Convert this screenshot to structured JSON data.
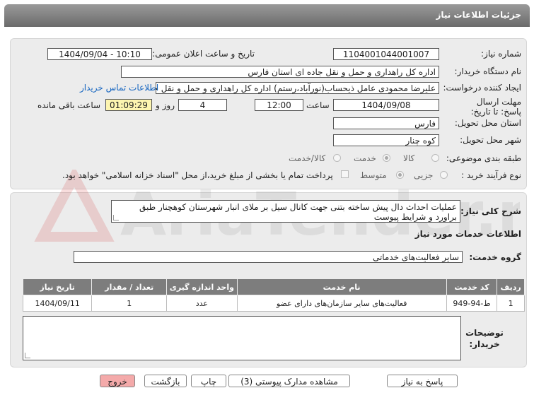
{
  "header": {
    "title": "جزئیات اطلاعات نیاز"
  },
  "form": {
    "need_number_label": "شماره نیاز:",
    "need_number": "1104001044001007",
    "announce_label": "تاریخ و ساعت اعلان عمومی:",
    "announce_value": "1404/09/04 - 10:10",
    "buyer_org_label": "نام دستگاه خریدار:",
    "buyer_org": "اداره کل راهداری و حمل و نقل جاده ای استان فارس",
    "creator_label": "ایجاد کننده درخواست:",
    "creator": "علیرضا محمودی عامل ذیحساب(نورآباد،رستم) اداره کل راهداری و حمل و نقل جا",
    "contact_link": "اطلاعات تماس خریدار",
    "deadline_label": "مهلت ارسال پاسخ: تا تاریخ:",
    "deadline_date": "1404/09/08",
    "time_label": "ساعت",
    "deadline_time": "12:00",
    "days_value": "4",
    "days_label": "روز و",
    "remaining_time": "01:09:29",
    "remaining_label": "ساعت باقی مانده",
    "province_label": "استان محل تحویل:",
    "province": "فارس",
    "city_label": "شهر محل تحویل:",
    "city": "کوه چنار",
    "category_label": "طبقه بندی موضوعی:",
    "category_options": [
      "کالا",
      "خدمت",
      "کالا/خدمت"
    ],
    "category_selected": "خدمت",
    "process_label": "نوع فرآیند خرید :",
    "process_options": [
      "جزیی",
      "متوسط"
    ],
    "process_selected": "متوسط",
    "payment_note": "پرداخت تمام یا بخشی از مبلغ خرید،از محل \"اسناد خزانه اسلامی\" خواهد بود."
  },
  "details": {
    "description_label": "شرح کلی نیاز:",
    "description": "عملیات احداث دال پیش ساخته بتنی جهت کانال سیل بر ملای انبار شهرستان کوهچنار طبق براورد و شرایط پیوست",
    "services_heading": "اطلاعات خدمات مورد نیاز",
    "service_group_label": "گروه خدمت:",
    "service_group": "سایر فعالیت‌های خدماتی",
    "table": {
      "headers": [
        "ردیف",
        "کد خدمت",
        "نام خدمت",
        "واحد اندازه گیری",
        "تعداد / مقدار",
        "تاریخ نیاز"
      ],
      "rows": [
        [
          "1",
          "ط-94-949",
          "فعالیت‌های سایر سازمان‌های دارای عضو",
          "عدد",
          "1",
          "1404/09/11"
        ]
      ]
    },
    "buyer_notes_label": "توضیحات خریدار:",
    "buyer_notes": ""
  },
  "buttons": {
    "reply": "پاسخ به نیاز",
    "attachments": "مشاهده مدارک پیوستی (3)",
    "print": "چاپ",
    "back": "بازگشت",
    "exit": "خروج"
  },
  "watermark": {
    "text": "AriaTender.net"
  },
  "colors": {
    "header": "#7a7a7a",
    "panel": "#ececec",
    "link": "#1565c0",
    "exit_button": "#f4aaaa"
  }
}
